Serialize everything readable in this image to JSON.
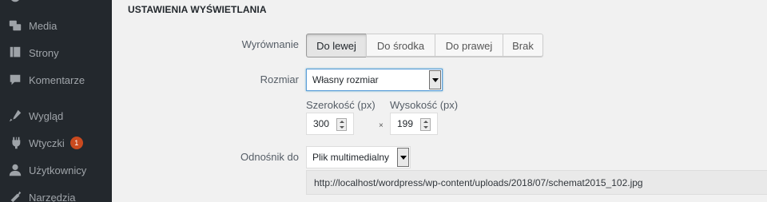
{
  "sidebar": {
    "items": [
      {
        "label": "Media",
        "icon": "media-icon"
      },
      {
        "label": "Strony",
        "icon": "pages-icon"
      },
      {
        "label": "Komentarze",
        "icon": "comments-icon"
      },
      {
        "label": "Wygląd",
        "icon": "appearance-icon"
      },
      {
        "label": "Wtyczki",
        "icon": "plugins-icon",
        "badge": "1"
      },
      {
        "label": "Użytkownicy",
        "icon": "users-icon"
      },
      {
        "label": "Narzędzia",
        "icon": "tools-icon"
      }
    ]
  },
  "display_settings": {
    "title": "USTAWIENIA WYŚWIETLANIA",
    "alignment": {
      "label": "Wyrównanie",
      "options": [
        "Do lewej",
        "Do środka",
        "Do prawej",
        "Brak"
      ],
      "selected": "Do lewej"
    },
    "size": {
      "label": "Rozmiar",
      "value": "Własny rozmiar"
    },
    "custom_size": {
      "width_label": "Szerokość (px)",
      "width_value": "300",
      "height_label": "Wysokość (px)",
      "height_value": "199",
      "separator": "×"
    },
    "link_to": {
      "label": "Odnośnik do",
      "value": "Plik multimedialny",
      "url": "http://localhost/wordpress/wp-content/uploads/2018/07/schemat2015_102.jpg"
    }
  },
  "colors": {
    "sidebar_bg": "#23282d",
    "sidebar_text": "#a0a5aa",
    "badge_bg": "#ca4a1f",
    "focus_border": "#5b9dd9",
    "panel_bg": "#f1f1f1"
  }
}
